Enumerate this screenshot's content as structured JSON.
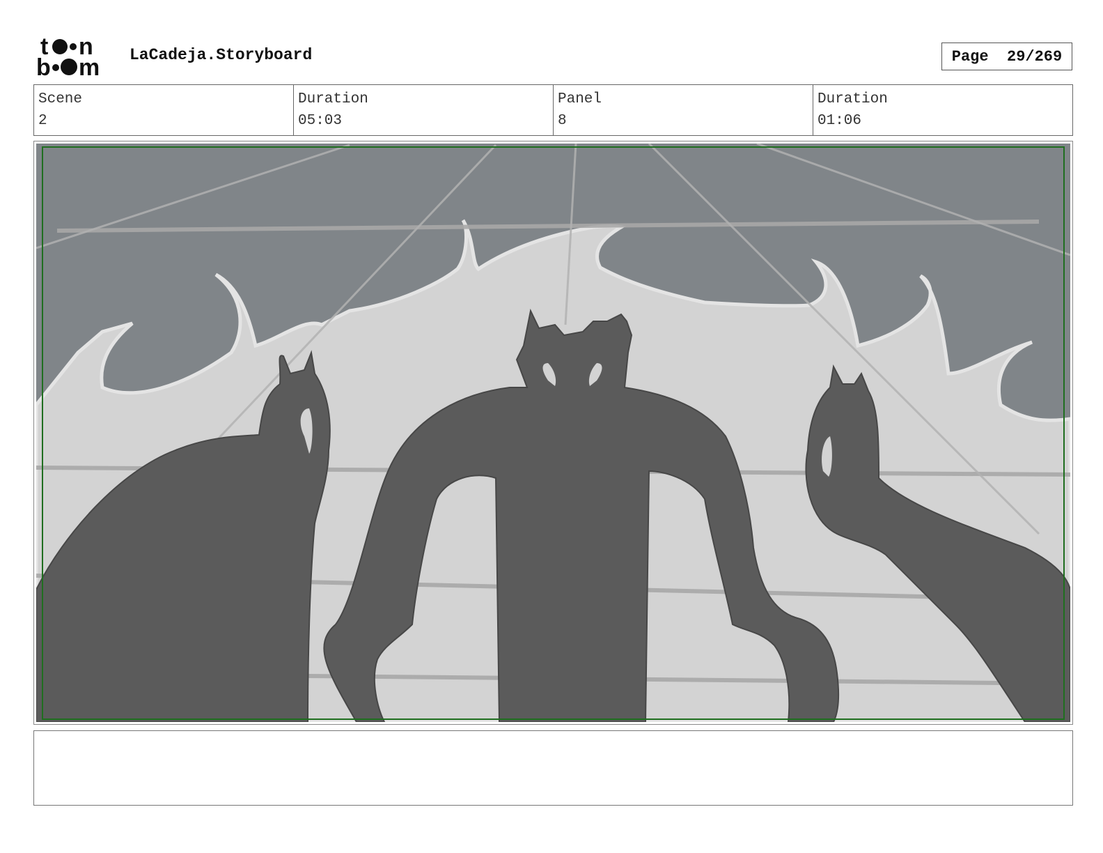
{
  "header": {
    "logo_text": "toon boom",
    "project_title": "LaCadeja.Storyboard",
    "page_label": "Page  29/269"
  },
  "info": {
    "scene_label": "Scene",
    "scene_value": "2",
    "scene_duration_label": "Duration",
    "scene_duration_value": "05:03",
    "panel_label": "Panel",
    "panel_value": "8",
    "panel_duration_label": "Duration",
    "panel_duration_value": "01:06"
  },
  "panel": {
    "sky_color": "#808589",
    "flame_color": "#d3d3d3",
    "figure_color": "#5b5b5b",
    "safe_frame_color": "#1f6e1f"
  },
  "notes": {
    "text": ""
  }
}
